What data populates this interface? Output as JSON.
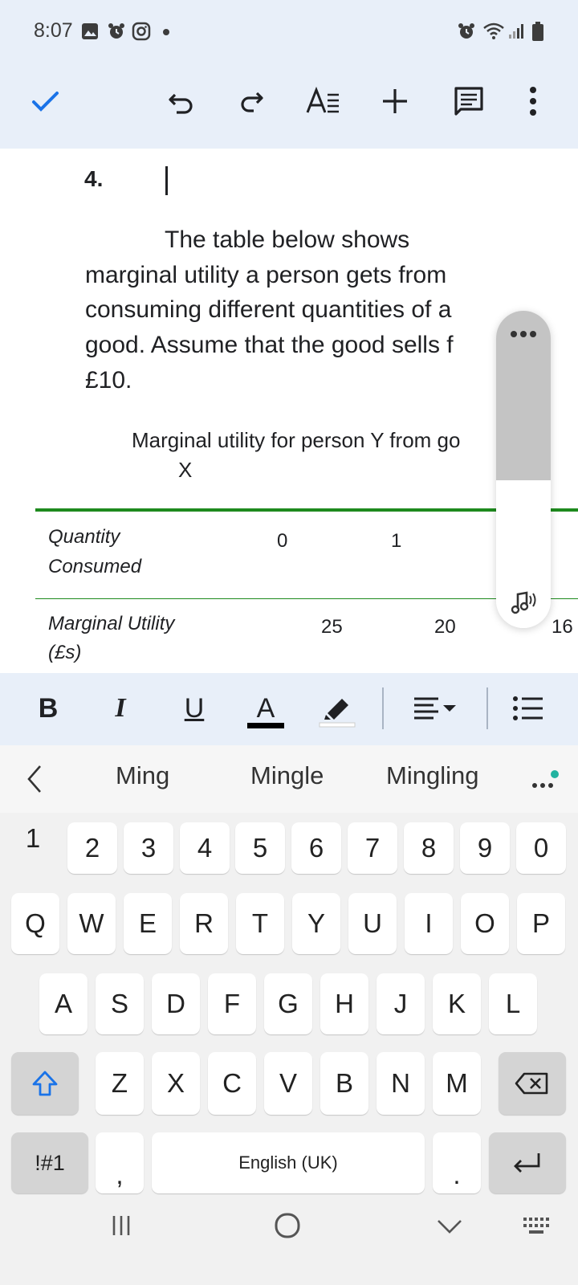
{
  "status_bar": {
    "time": "8:07"
  },
  "toolbar": {
    "done_icon": "check-icon",
    "undo_icon": "undo-icon",
    "redo_icon": "redo-icon",
    "text_format_icon": "text-format-icon",
    "insert_icon": "plus-icon",
    "comment_icon": "comment-icon",
    "more_icon": "more-vert-icon"
  },
  "document": {
    "list_number": "4.",
    "paragraph_lines": [
      "The table below shows",
      "marginal utility a person gets from",
      "consuming different quantities of a",
      "good. Assume that the good sells f",
      "£10."
    ],
    "table_caption_lines": [
      "Marginal utility for person Y from go",
      "X"
    ],
    "table": {
      "row1_label_lines": [
        "Quantity",
        "Consumed"
      ],
      "row1_values": [
        "0",
        "1"
      ],
      "row2_label_lines": [
        "Marginal Utility",
        "(£s)"
      ],
      "row2_values": [
        "25",
        "20",
        "16"
      ]
    },
    "accent_color": "#1e8a1e"
  },
  "format_bar": {
    "bold": "B",
    "italic": "I",
    "underline": "U",
    "text_color": "A"
  },
  "suggestions": [
    "Ming",
    "Mingle",
    "Mingling"
  ],
  "keyboard": {
    "number_row": [
      "1",
      "2",
      "3",
      "4",
      "5",
      "6",
      "7",
      "8",
      "9",
      "0"
    ],
    "row_q": [
      "Q",
      "W",
      "E",
      "R",
      "T",
      "Y",
      "U",
      "I",
      "O",
      "P"
    ],
    "row_a": [
      "A",
      "S",
      "D",
      "F",
      "G",
      "H",
      "J",
      "K",
      "L"
    ],
    "row_z": [
      "Z",
      "X",
      "C",
      "V",
      "B",
      "N",
      "M"
    ],
    "symbols_label": "!#1",
    "comma": ",",
    "space_label": "English (UK)",
    "period": "."
  },
  "colors": {
    "toolbar_bg": "#e8eff9",
    "check": "#1a73e8"
  }
}
